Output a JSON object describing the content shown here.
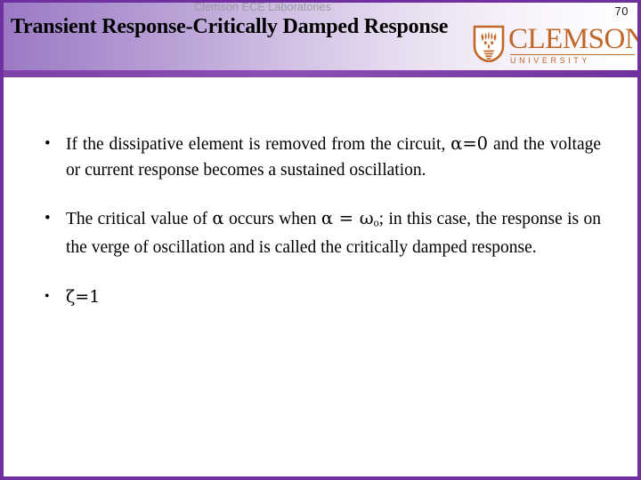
{
  "slide": {
    "header": {
      "eyebrow": "Clemson ECE Laboratories",
      "title": "Transient Response-Critically Damped Response",
      "page_number": "70",
      "accent_color": "#7030a0",
      "gradient_start": "#9b79c4",
      "gradient_end": "#ffffff"
    },
    "logo": {
      "wordmark": "CLEMSON",
      "subtext": "UNIVERSITY",
      "mark_name": "clemson-tiger-shield",
      "color": "#c0682a"
    },
    "body": {
      "bullets": [
        {
          "marker": "•",
          "style": "serif-justified",
          "text_parts": [
            {
              "type": "text",
              "value": "If the dissipative element is removed from the circuit, "
            },
            {
              "type": "symbol",
              "value": "α=0"
            },
            {
              "type": "text",
              "value": " and the voltage or current response becomes a sustained oscillation."
            }
          ],
          "plain_text": "If the dissipative element is removed from the circuit, α=0 and the voltage or current response becomes a sustained oscillation."
        },
        {
          "marker": "•",
          "style": "serif-justified",
          "text_parts": [
            {
              "type": "text",
              "value": "The critical value of "
            },
            {
              "type": "symbol",
              "value": "α"
            },
            {
              "type": "text",
              "value": " occurs when "
            },
            {
              "type": "symbol",
              "value": "α = ω"
            },
            {
              "type": "subscript",
              "value": "o"
            },
            {
              "type": "text",
              "value": "; in this case, the response is on the verge of oscillation and is called the critically damped response."
            }
          ],
          "plain_text": "The critical value of α occurs when α = ωo; in this case, the response is on the verge of oscillation and is called the critically damped response."
        },
        {
          "marker": "•",
          "style": "sans",
          "text_parts": [
            {
              "type": "symbol",
              "value": "ζ=1"
            }
          ],
          "plain_text": "ζ=1"
        }
      ]
    }
  }
}
